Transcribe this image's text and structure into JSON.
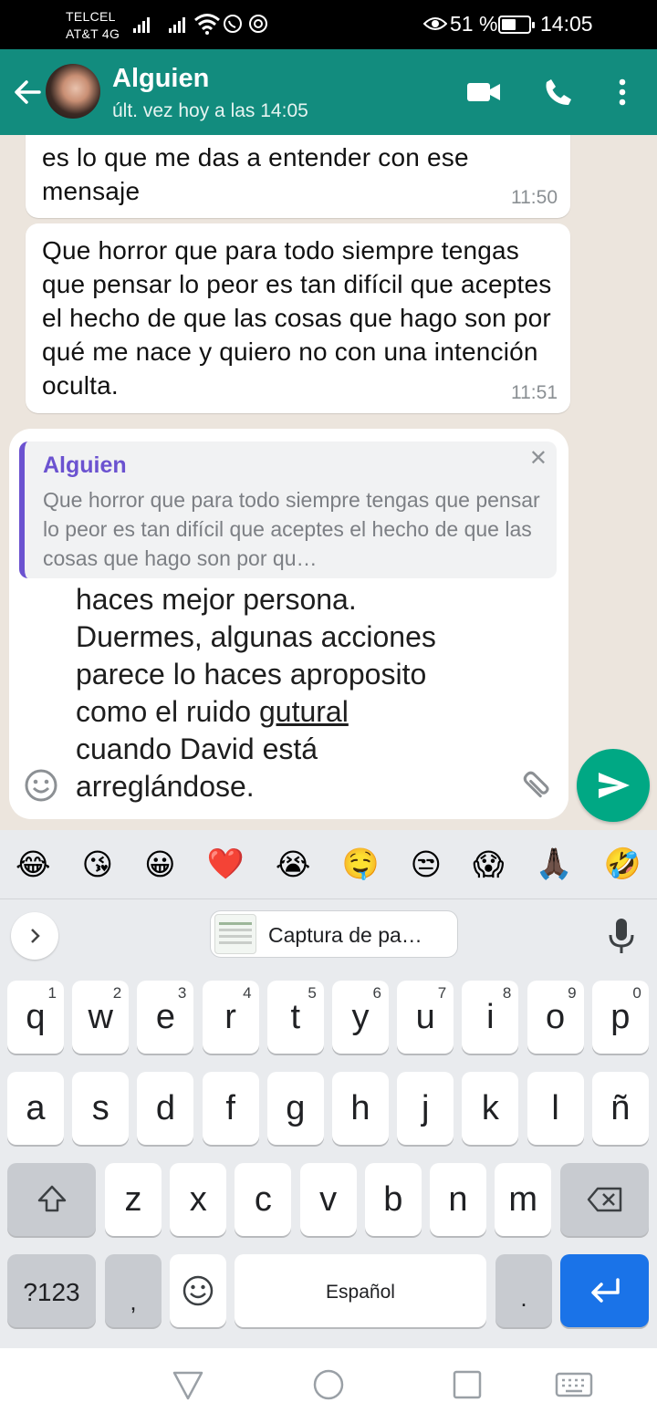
{
  "status_bar": {
    "carrier1": "TELCEL",
    "carrier2": "AT&T 4G",
    "battery_percent": "51 %",
    "time": "14:05"
  },
  "header": {
    "contact_name": "Alguien",
    "last_seen": "últ. vez hoy a las 14:05",
    "icons": [
      "back-arrow-icon",
      "video-call-icon",
      "voice-call-icon",
      "more-options-icon"
    ]
  },
  "messages": [
    {
      "text": "es lo que me das a entender con ese mensaje",
      "time": "11:50"
    },
    {
      "text": "Que horror que para todo siempre tengas que pensar lo peor es tan difícil que aceptes el hecho de que las cosas que hago son por qué me nace y quiero no con una intención oculta.",
      "time": "11:51"
    }
  ],
  "reply_preview": {
    "author": "Alguien",
    "text": "Que horror que para todo siempre tengas que pensar lo peor es tan difícil que aceptes el hecho de que las cosas que hago son por qu…"
  },
  "compose": {
    "line1": "haces mejor persona.",
    "line2": "Duermes, algunas acciones",
    "line3": "parece lo haces aproposito",
    "line4_pre": "como el ruido ",
    "line4_underlined": "gutural",
    "line5": "cuando David está",
    "line6": "arreglándose."
  },
  "keyboard": {
    "emoji_suggestions": [
      "😂",
      "😘",
      "😀",
      "❤️",
      "😭",
      "🤤",
      "😒",
      "😱",
      "🙏🏿",
      "🤣"
    ],
    "clipboard_chip": "Captura de pa…",
    "row1": [
      {
        "key": "q",
        "hint": "1"
      },
      {
        "key": "w",
        "hint": "2"
      },
      {
        "key": "e",
        "hint": "3"
      },
      {
        "key": "r",
        "hint": "4"
      },
      {
        "key": "t",
        "hint": "5"
      },
      {
        "key": "y",
        "hint": "6"
      },
      {
        "key": "u",
        "hint": "7"
      },
      {
        "key": "i",
        "hint": "8"
      },
      {
        "key": "o",
        "hint": "9"
      },
      {
        "key": "p",
        "hint": "0"
      }
    ],
    "row2": [
      "a",
      "s",
      "d",
      "f",
      "g",
      "h",
      "j",
      "k",
      "l",
      "ñ"
    ],
    "row3": [
      "z",
      "x",
      "c",
      "v",
      "b",
      "n",
      "m"
    ],
    "symbols_key": "?123",
    "comma_key": ",",
    "space_label": "Español",
    "period_key": "."
  },
  "colors": {
    "header": "#128c7e",
    "send_button": "#00a884",
    "reply_accent": "#6b52d0",
    "enter_key": "#1a73e8",
    "chat_background": "#ece5dd"
  }
}
